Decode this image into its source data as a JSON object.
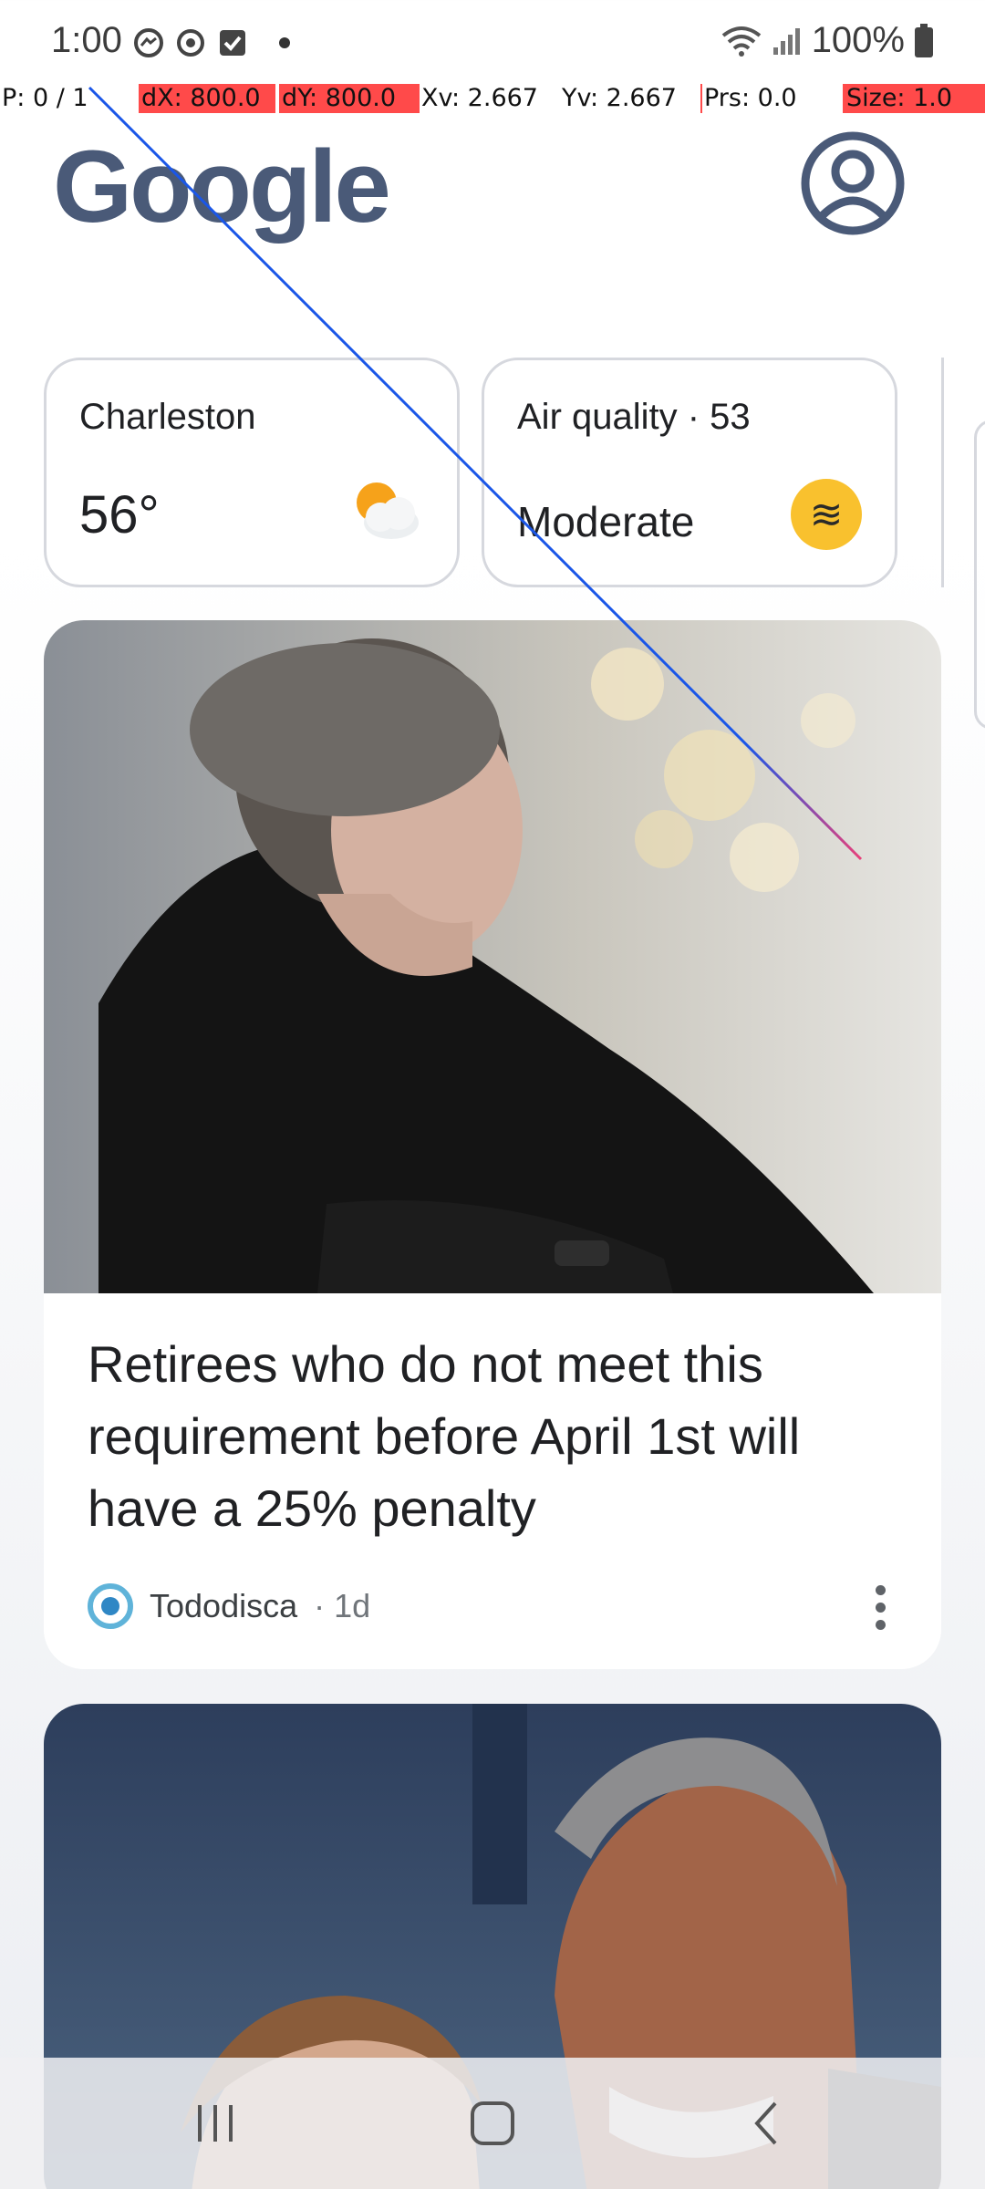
{
  "status_bar": {
    "time": "1:00",
    "battery": "100%",
    "icons": [
      "messenger-icon",
      "sync-icon",
      "checkbox-icon",
      "dot-icon",
      "wifi-icon",
      "signal-icon",
      "battery-icon"
    ]
  },
  "pointer_overlay": {
    "pointer": "P: 0 / 1",
    "dx": "dX: 800.0",
    "dy": "dY: 800.0",
    "xv": "Xv: 2.667",
    "yv": "Yv: 2.667",
    "prs": "Prs: 0.0",
    "size": "Size: 1.0",
    "highlight_color": "#ff4a4a",
    "trace_color": "#1a56e8"
  },
  "header": {
    "logo": "Google",
    "account_icon": "account-circle-icon"
  },
  "weather_card": {
    "city": "Charleston",
    "temperature": "56°",
    "icon": "partly-cloudy-icon"
  },
  "air_quality_card": {
    "title": "Air quality · 53",
    "status": "Moderate",
    "icon": "air-waves-icon",
    "badge_color": "#f9c12e"
  },
  "feed": [
    {
      "title": "Retirees who do not meet this requirement before April 1st will have a 25% penalty",
      "source": "Tododisca",
      "age": "· 1d",
      "image": "elderly-woman-photo"
    },
    {
      "image": "couple-photo"
    }
  ],
  "nav": {
    "recents": "recents-icon",
    "home": "home-icon",
    "back": "back-icon"
  }
}
